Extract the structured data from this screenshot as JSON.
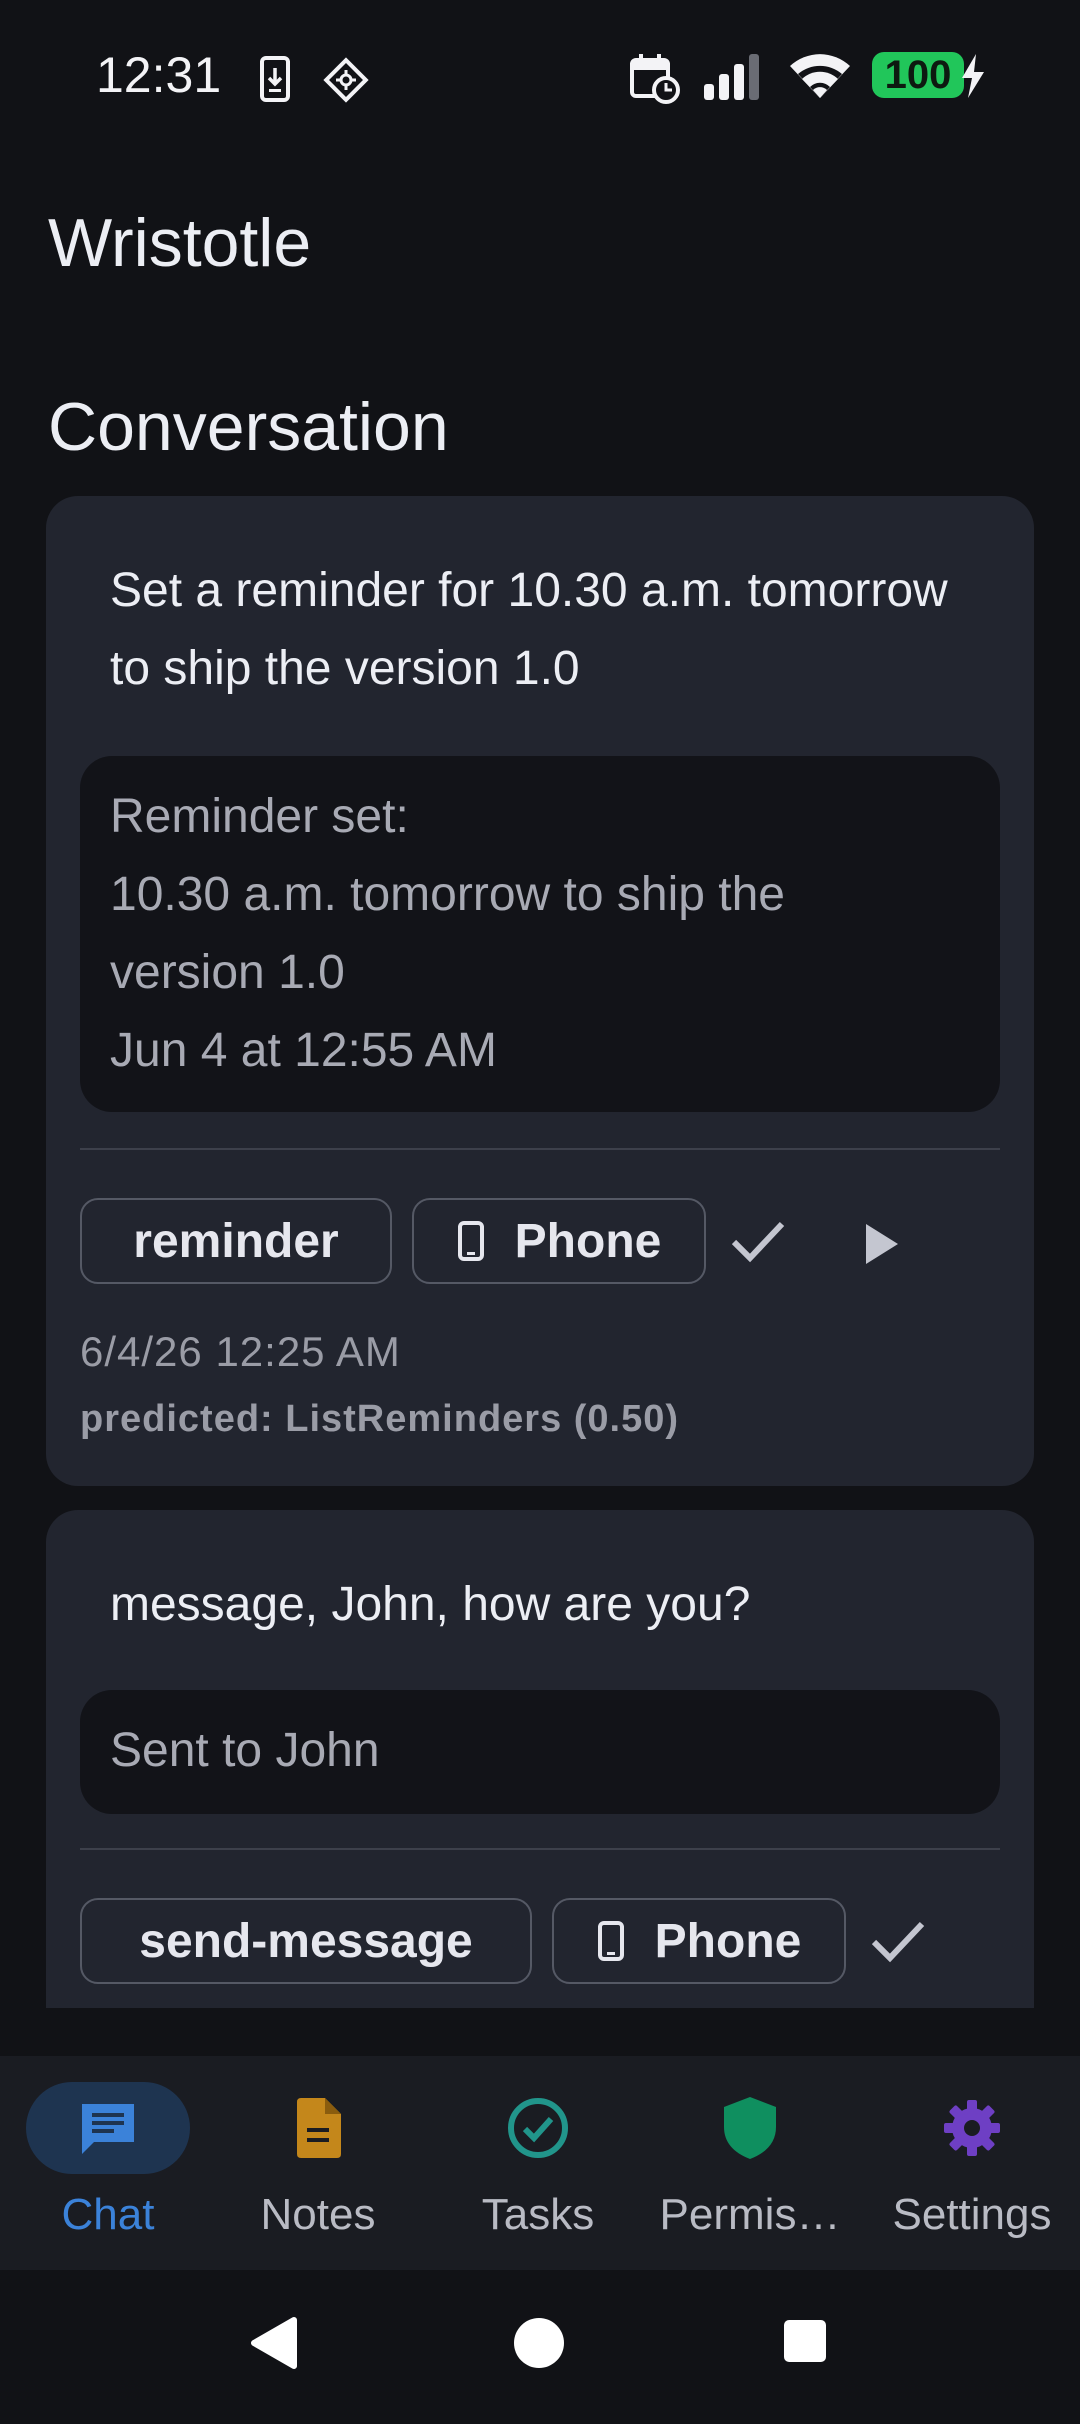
{
  "status": {
    "time": "12:31",
    "battery": "100"
  },
  "app_title": "Wristotle",
  "section_title": "Conversation",
  "cards": [
    {
      "prompt": "Set a reminder for 10.30 a.m. tomorrow to ship the version 1.0",
      "reply_lines": [
        "Reminder set:",
        "10.30 a.m. tomorrow to ship the",
        "version 1.0",
        "Jun 4 at 12:55 AM"
      ],
      "tag": "reminder",
      "device": "Phone",
      "timestamp": "6/4/26 12:25 AM",
      "predicted": "predicted: ListReminders (0.50)"
    },
    {
      "prompt": "message, John, how are you?",
      "reply_lines": [
        "Sent to John"
      ],
      "tag": "send-message",
      "device": "Phone"
    }
  ],
  "nav": {
    "items": [
      {
        "label": "Chat",
        "icon": "chat-icon",
        "color": "#3b82d9"
      },
      {
        "label": "Notes",
        "icon": "note-icon",
        "color": "#c4871b"
      },
      {
        "label": "Tasks",
        "icon": "check-circle-icon",
        "color": "#21958b"
      },
      {
        "label": "Permis…",
        "icon": "shield-icon",
        "color": "#0f8f5f"
      },
      {
        "label": "Settings",
        "icon": "gear-icon",
        "color": "#6e3fc4"
      }
    ],
    "active": "Chat"
  },
  "colors": {
    "background": "#111216",
    "card": "#22252f",
    "accent": "#3b82d9",
    "battery": "#21c65a"
  }
}
